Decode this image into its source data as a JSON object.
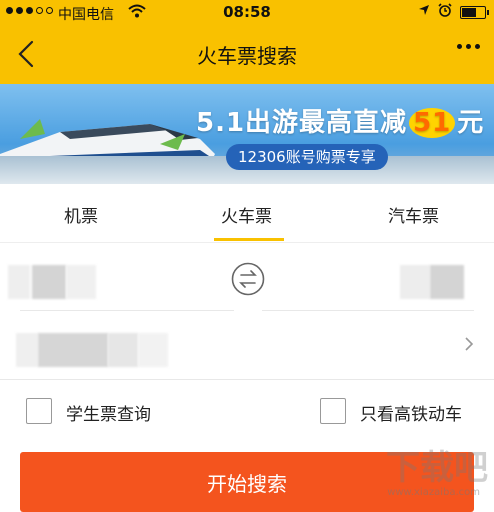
{
  "status_bar": {
    "carrier": "中国电信",
    "time": "08:58"
  },
  "nav": {
    "title": "火车票搜索"
  },
  "banner": {
    "headline_pre": "5.1出游最高直减",
    "headline_num": "51",
    "headline_post": "元",
    "subtitle": "12306账号购票专享"
  },
  "tabs": [
    {
      "label": "机票",
      "active": false
    },
    {
      "label": "火车票",
      "active": true
    },
    {
      "label": "汽车票",
      "active": false
    }
  ],
  "options": {
    "student_label": "学生票查询",
    "high_speed_label": "只看高铁动车"
  },
  "search_button": {
    "label": "开始搜索"
  },
  "watermark": {
    "text": "下载吧",
    "url": "www.xiazaiba.com"
  },
  "colors": {
    "brand_yellow": "#f9c100",
    "search_orange": "#f4541e"
  }
}
